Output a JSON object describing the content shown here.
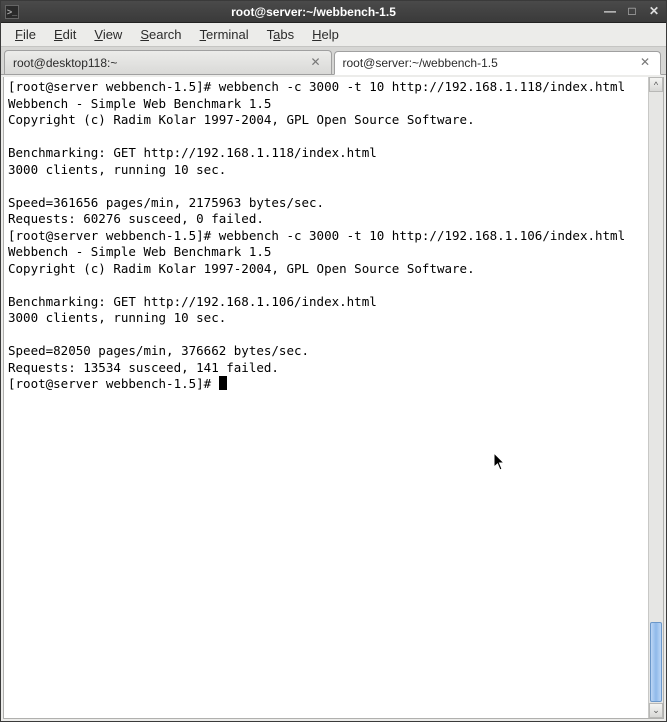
{
  "window": {
    "title": "root@server:~/webbench-1.5"
  },
  "menubar": {
    "items": [
      {
        "label": "File",
        "accel": "F"
      },
      {
        "label": "Edit",
        "accel": "E"
      },
      {
        "label": "View",
        "accel": "V"
      },
      {
        "label": "Search",
        "accel": "S"
      },
      {
        "label": "Terminal",
        "accel": "T"
      },
      {
        "label": "Tabs",
        "accel": "a"
      },
      {
        "label": "Help",
        "accel": "H"
      }
    ]
  },
  "tabs": [
    {
      "label": "root@desktop118:~",
      "active": false
    },
    {
      "label": "root@server:~/webbench-1.5",
      "active": true
    }
  ],
  "terminal": {
    "prompt": "[root@server webbench-1.5]# ",
    "lines": [
      "[root@server webbench-1.5]# webbench -c 3000 -t 10 http://192.168.1.118/index.html",
      "Webbench - Simple Web Benchmark 1.5",
      "Copyright (c) Radim Kolar 1997-2004, GPL Open Source Software.",
      "",
      "Benchmarking: GET http://192.168.1.118/index.html",
      "3000 clients, running 10 sec.",
      "",
      "Speed=361656 pages/min, 2175963 bytes/sec.",
      "Requests: 60276 susceed, 0 failed.",
      "[root@server webbench-1.5]# webbench -c 3000 -t 10 http://192.168.1.106/index.html",
      "Webbench - Simple Web Benchmark 1.5",
      "Copyright (c) Radim Kolar 1997-2004, GPL Open Source Software.",
      "",
      "Benchmarking: GET http://192.168.1.106/index.html",
      "3000 clients, running 10 sec.",
      "",
      "Speed=82050 pages/min, 376662 bytes/sec.",
      "Requests: 13534 susceed, 141 failed."
    ]
  },
  "icons": {
    "minimize": "—",
    "maximize": "□",
    "close": "✕",
    "tab_close": "✕",
    "scroll_up": "^",
    "scroll_down": "⌄",
    "app": ">_"
  }
}
